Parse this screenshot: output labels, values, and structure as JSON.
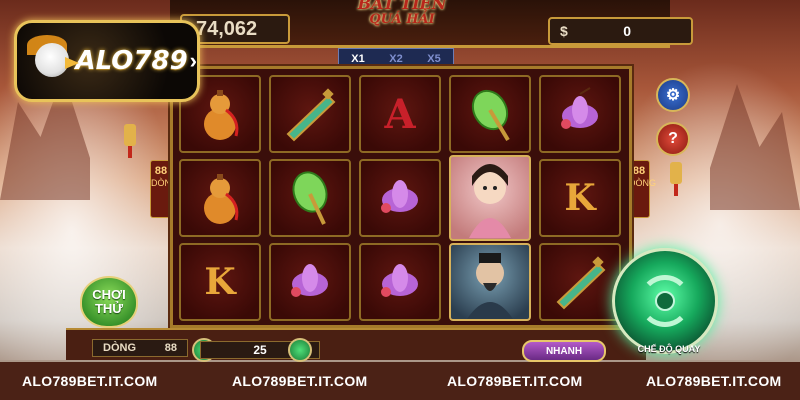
{
  "header": {
    "credit_value": "74,062",
    "game_title_line1": "BAT TIEN",
    "game_title_line2": "QUÁ HẢI",
    "win_currency": "$",
    "win_value": "0",
    "multipliers": [
      "X1",
      "X2",
      "X5"
    ],
    "active_multiplier": "X1"
  },
  "logo": {
    "text": "ALO789",
    "arrow": "›"
  },
  "board": {
    "side_lines_value": "88",
    "side_lines_label": "DÒNG",
    "reels": [
      [
        "gourd-icon",
        "jade-sword-icon",
        "letter-a",
        "jade-fan-icon",
        "lotus-icon"
      ],
      [
        "gourd-icon",
        "jade-fan-icon",
        "lotus-icon",
        "immortal-lady-portrait",
        "letter-k"
      ],
      [
        "letter-k",
        "lotus-icon",
        "lotus-icon",
        "immortal-warrior-portrait",
        "jade-sword-icon"
      ]
    ],
    "letter_a": "A",
    "letter_k": "K"
  },
  "controls": {
    "try_play_line1": "CHƠI",
    "try_play_line2": "THỬ",
    "lines_label": "DÒNG",
    "lines_value": "88",
    "bet_value": "25",
    "fast_label": "NHANH",
    "spin_label": "CHẾ ĐỘ QUAY"
  },
  "footer": {
    "links": [
      "ALO789BET.IT.COM",
      "ALO789BET.IT.COM",
      "ALO789BET.IT.COM",
      "ALO789BET.IT.COM"
    ]
  },
  "colors": {
    "gold": "#c89a3a",
    "board_bg": "#3a0e0a",
    "footer_bg": "#4b2216",
    "spin_green": "#16a85c"
  }
}
